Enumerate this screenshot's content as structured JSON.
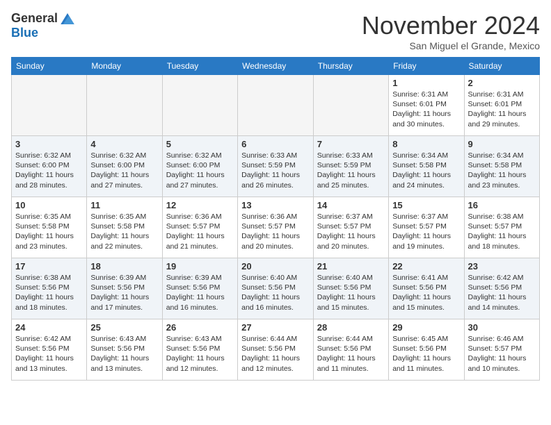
{
  "header": {
    "logo": {
      "general": "General",
      "blue": "Blue",
      "tagline": ""
    },
    "title": "November 2024",
    "subtitle": "San Miguel el Grande, Mexico"
  },
  "calendar": {
    "days_of_week": [
      "Sunday",
      "Monday",
      "Tuesday",
      "Wednesday",
      "Thursday",
      "Friday",
      "Saturday"
    ],
    "weeks": [
      {
        "alt": false,
        "days": [
          {
            "num": "",
            "empty": true
          },
          {
            "num": "",
            "empty": true
          },
          {
            "num": "",
            "empty": true
          },
          {
            "num": "",
            "empty": true
          },
          {
            "num": "",
            "empty": true
          },
          {
            "num": "1",
            "sunrise": "Sunrise: 6:31 AM",
            "sunset": "Sunset: 6:01 PM",
            "daylight": "Daylight: 11 hours and 30 minutes."
          },
          {
            "num": "2",
            "sunrise": "Sunrise: 6:31 AM",
            "sunset": "Sunset: 6:01 PM",
            "daylight": "Daylight: 11 hours and 29 minutes."
          }
        ]
      },
      {
        "alt": true,
        "days": [
          {
            "num": "3",
            "sunrise": "Sunrise: 6:32 AM",
            "sunset": "Sunset: 6:00 PM",
            "daylight": "Daylight: 11 hours and 28 minutes."
          },
          {
            "num": "4",
            "sunrise": "Sunrise: 6:32 AM",
            "sunset": "Sunset: 6:00 PM",
            "daylight": "Daylight: 11 hours and 27 minutes."
          },
          {
            "num": "5",
            "sunrise": "Sunrise: 6:32 AM",
            "sunset": "Sunset: 6:00 PM",
            "daylight": "Daylight: 11 hours and 27 minutes."
          },
          {
            "num": "6",
            "sunrise": "Sunrise: 6:33 AM",
            "sunset": "Sunset: 5:59 PM",
            "daylight": "Daylight: 11 hours and 26 minutes."
          },
          {
            "num": "7",
            "sunrise": "Sunrise: 6:33 AM",
            "sunset": "Sunset: 5:59 PM",
            "daylight": "Daylight: 11 hours and 25 minutes."
          },
          {
            "num": "8",
            "sunrise": "Sunrise: 6:34 AM",
            "sunset": "Sunset: 5:58 PM",
            "daylight": "Daylight: 11 hours and 24 minutes."
          },
          {
            "num": "9",
            "sunrise": "Sunrise: 6:34 AM",
            "sunset": "Sunset: 5:58 PM",
            "daylight": "Daylight: 11 hours and 23 minutes."
          }
        ]
      },
      {
        "alt": false,
        "days": [
          {
            "num": "10",
            "sunrise": "Sunrise: 6:35 AM",
            "sunset": "Sunset: 5:58 PM",
            "daylight": "Daylight: 11 hours and 23 minutes."
          },
          {
            "num": "11",
            "sunrise": "Sunrise: 6:35 AM",
            "sunset": "Sunset: 5:58 PM",
            "daylight": "Daylight: 11 hours and 22 minutes."
          },
          {
            "num": "12",
            "sunrise": "Sunrise: 6:36 AM",
            "sunset": "Sunset: 5:57 PM",
            "daylight": "Daylight: 11 hours and 21 minutes."
          },
          {
            "num": "13",
            "sunrise": "Sunrise: 6:36 AM",
            "sunset": "Sunset: 5:57 PM",
            "daylight": "Daylight: 11 hours and 20 minutes."
          },
          {
            "num": "14",
            "sunrise": "Sunrise: 6:37 AM",
            "sunset": "Sunset: 5:57 PM",
            "daylight": "Daylight: 11 hours and 20 minutes."
          },
          {
            "num": "15",
            "sunrise": "Sunrise: 6:37 AM",
            "sunset": "Sunset: 5:57 PM",
            "daylight": "Daylight: 11 hours and 19 minutes."
          },
          {
            "num": "16",
            "sunrise": "Sunrise: 6:38 AM",
            "sunset": "Sunset: 5:57 PM",
            "daylight": "Daylight: 11 hours and 18 minutes."
          }
        ]
      },
      {
        "alt": true,
        "days": [
          {
            "num": "17",
            "sunrise": "Sunrise: 6:38 AM",
            "sunset": "Sunset: 5:56 PM",
            "daylight": "Daylight: 11 hours and 18 minutes."
          },
          {
            "num": "18",
            "sunrise": "Sunrise: 6:39 AM",
            "sunset": "Sunset: 5:56 PM",
            "daylight": "Daylight: 11 hours and 17 minutes."
          },
          {
            "num": "19",
            "sunrise": "Sunrise: 6:39 AM",
            "sunset": "Sunset: 5:56 PM",
            "daylight": "Daylight: 11 hours and 16 minutes."
          },
          {
            "num": "20",
            "sunrise": "Sunrise: 6:40 AM",
            "sunset": "Sunset: 5:56 PM",
            "daylight": "Daylight: 11 hours and 16 minutes."
          },
          {
            "num": "21",
            "sunrise": "Sunrise: 6:40 AM",
            "sunset": "Sunset: 5:56 PM",
            "daylight": "Daylight: 11 hours and 15 minutes."
          },
          {
            "num": "22",
            "sunrise": "Sunrise: 6:41 AM",
            "sunset": "Sunset: 5:56 PM",
            "daylight": "Daylight: 11 hours and 15 minutes."
          },
          {
            "num": "23",
            "sunrise": "Sunrise: 6:42 AM",
            "sunset": "Sunset: 5:56 PM",
            "daylight": "Daylight: 11 hours and 14 minutes."
          }
        ]
      },
      {
        "alt": false,
        "days": [
          {
            "num": "24",
            "sunrise": "Sunrise: 6:42 AM",
            "sunset": "Sunset: 5:56 PM",
            "daylight": "Daylight: 11 hours and 13 minutes."
          },
          {
            "num": "25",
            "sunrise": "Sunrise: 6:43 AM",
            "sunset": "Sunset: 5:56 PM",
            "daylight": "Daylight: 11 hours and 13 minutes."
          },
          {
            "num": "26",
            "sunrise": "Sunrise: 6:43 AM",
            "sunset": "Sunset: 5:56 PM",
            "daylight": "Daylight: 11 hours and 12 minutes."
          },
          {
            "num": "27",
            "sunrise": "Sunrise: 6:44 AM",
            "sunset": "Sunset: 5:56 PM",
            "daylight": "Daylight: 11 hours and 12 minutes."
          },
          {
            "num": "28",
            "sunrise": "Sunrise: 6:44 AM",
            "sunset": "Sunset: 5:56 PM",
            "daylight": "Daylight: 11 hours and 11 minutes."
          },
          {
            "num": "29",
            "sunrise": "Sunrise: 6:45 AM",
            "sunset": "Sunset: 5:56 PM",
            "daylight": "Daylight: 11 hours and 11 minutes."
          },
          {
            "num": "30",
            "sunrise": "Sunrise: 6:46 AM",
            "sunset": "Sunset: 5:57 PM",
            "daylight": "Daylight: 11 hours and 10 minutes."
          }
        ]
      }
    ]
  }
}
